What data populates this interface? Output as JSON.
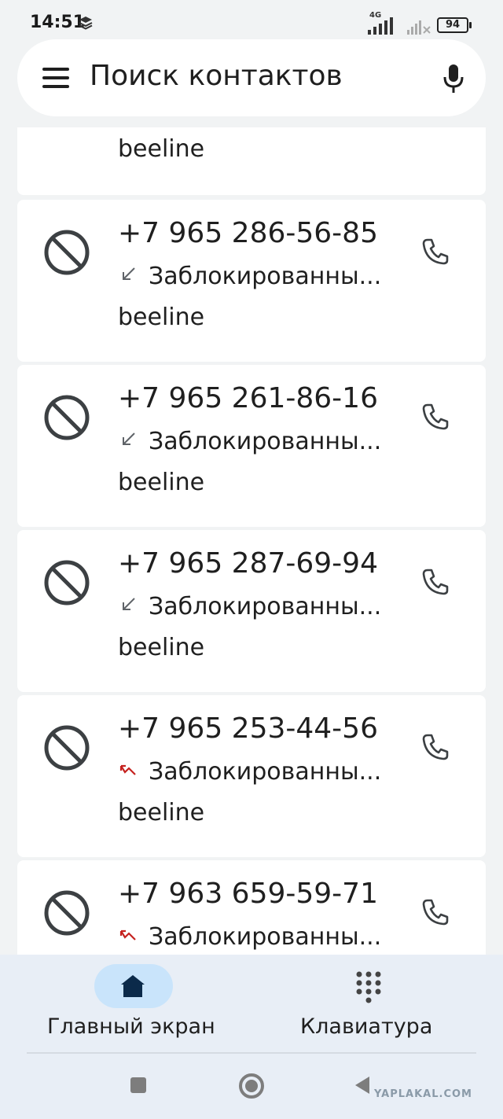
{
  "status_bar": {
    "time": "14:51",
    "network": "4G",
    "battery": "94"
  },
  "search": {
    "placeholder": "Поиск контактов",
    "menu_icon": "menu-icon",
    "mic_icon": "mic-icon"
  },
  "partial_top_card": {
    "carrier": "beeline"
  },
  "calls": [
    {
      "number": "+7 965 286-56-85",
      "status": "Заблокированны...",
      "carrier": "beeline",
      "arrow": "incoming",
      "arrow_color": "#5f6368"
    },
    {
      "number": "+7 965 261-86-16",
      "status": "Заблокированны...",
      "carrier": "beeline",
      "arrow": "incoming",
      "arrow_color": "#5f6368"
    },
    {
      "number": "+7 965 287-69-94",
      "status": "Заблокированны...",
      "carrier": "beeline",
      "arrow": "incoming",
      "arrow_color": "#5f6368"
    },
    {
      "number": "+7 965 253-44-56",
      "status": "Заблокированны...",
      "carrier": "beeline",
      "arrow": "missed",
      "arrow_color": "#c5221f"
    },
    {
      "number": "+7 963 659-59-71",
      "status": "Заблокированны...",
      "carrier": "",
      "arrow": "missed",
      "arrow_color": "#c5221f"
    }
  ],
  "bottom_nav": {
    "home_label": "Главный экран",
    "keypad_label": "Клавиатура",
    "active": "home"
  },
  "colors": {
    "background": "#f1f3f4",
    "card": "#ffffff",
    "nav_background": "#e8eef6",
    "active_pill": "#c9e4fb",
    "missed_arrow": "#c5221f"
  },
  "watermark": "YAPLAKAL.COM"
}
